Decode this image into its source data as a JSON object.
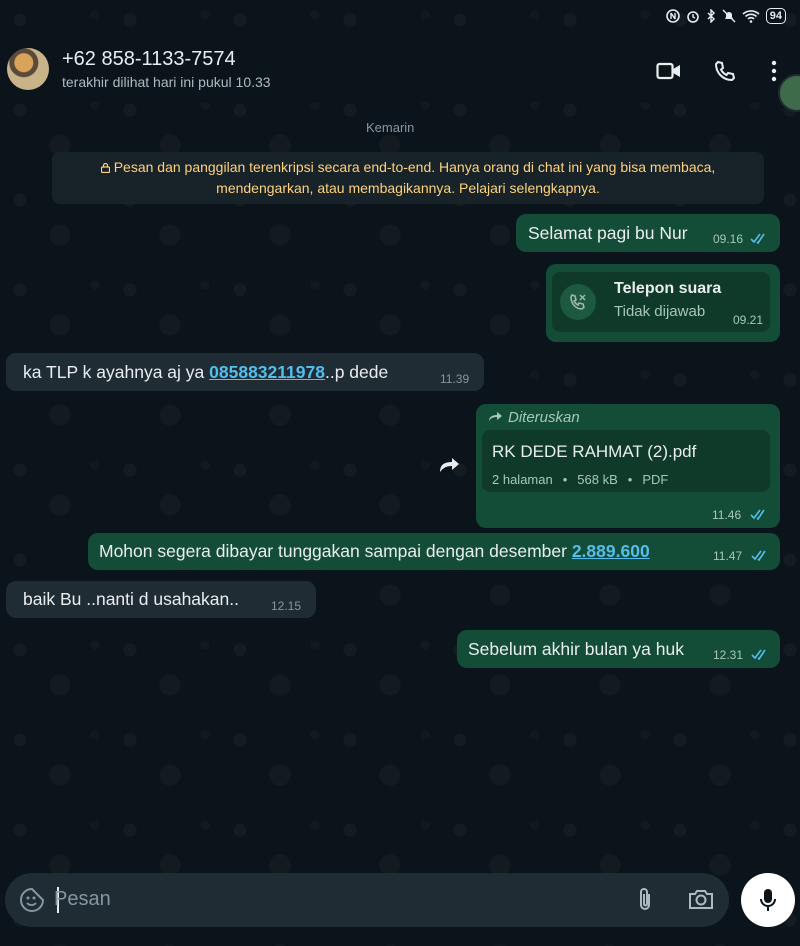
{
  "status": {
    "battery": "94"
  },
  "header": {
    "contact_name": "+62 858-1133-7574",
    "last_seen": "terakhir dilihat hari ini pukul 10.33",
    "icons": [
      "video-call-icon",
      "voice-call-icon",
      "more-options-icon"
    ]
  },
  "chat": {
    "date_label": "Kemarin",
    "encryption_notice_line1": "Pesan dan panggilan terenkripsi secara end-to-end. Hanya orang di chat ini yang bisa membaca,",
    "encryption_notice_line2": "mendengarkan, atau membagikannya. Pelajari selengkapnya.",
    "messages": [
      {
        "direction": "out",
        "text": "Selamat pagi bu Nur",
        "time": "09.16",
        "status": "read"
      },
      {
        "direction": "out",
        "type": "call",
        "call_title": "Telepon suara",
        "call_status": "Tidak dijawab",
        "time": "09.21"
      },
      {
        "direction": "in",
        "text_before": "ka TLP k ayahnya aj ya ",
        "link": "085883211978",
        "text_after": "..p dede",
        "time": "11.39"
      },
      {
        "direction": "out",
        "type": "document",
        "forwarded_label": "Diteruskan",
        "file_name": "RK DEDE RAHMAT (2).pdf",
        "pages": "2 halaman",
        "size": "568 kB",
        "file_type": "PDF",
        "time": "11.46",
        "status": "read"
      },
      {
        "direction": "out",
        "text_before": "Mohon segera dibayar tunggakan sampai dengan desember ",
        "link": "2.889.600",
        "time": "11.47",
        "status": "read"
      },
      {
        "direction": "in",
        "text": "baik Bu ..nanti d usahakan..",
        "time": "12.15"
      },
      {
        "direction": "out",
        "text": "Sebelum akhir bulan ya huk",
        "time": "12.31",
        "status": "read"
      }
    ]
  },
  "composer": {
    "placeholder": "Pesan"
  },
  "colors": {
    "background": "#0b141a",
    "outgoing_bubble": "#144d37",
    "incoming_bubble": "#202c33",
    "notice_text": "#ffd279",
    "read_ticks": "#53bdeb"
  }
}
